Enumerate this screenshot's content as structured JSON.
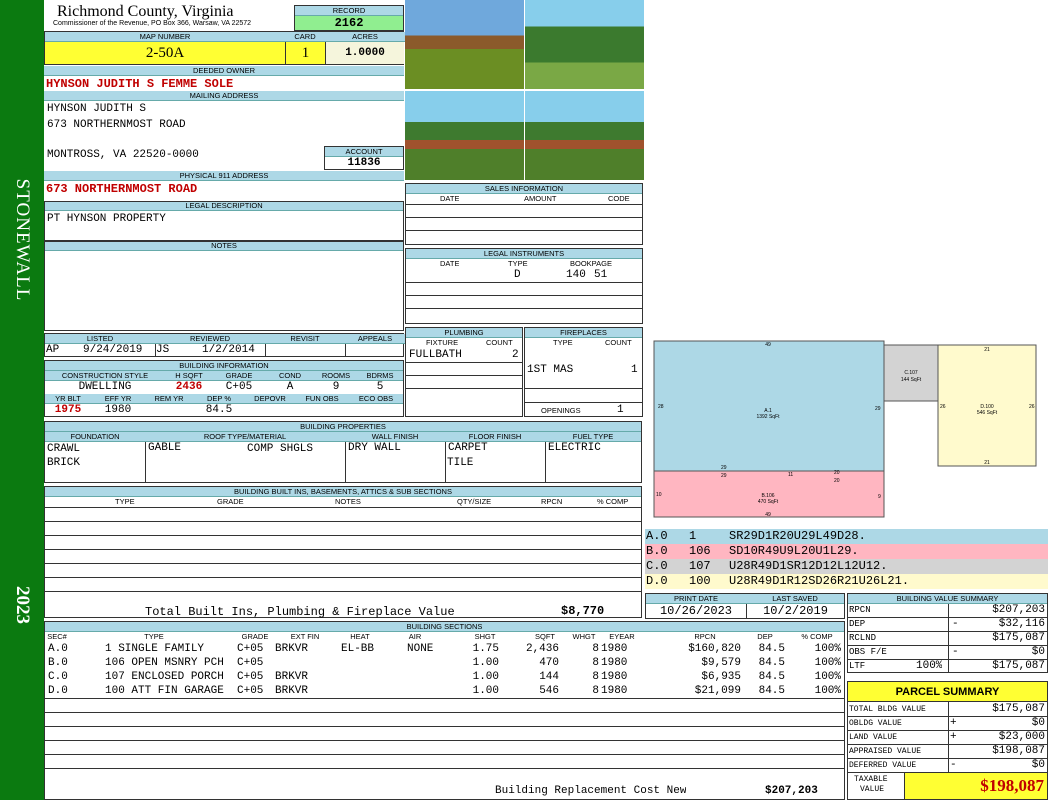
{
  "sidebar": {
    "district": "STONEWALL",
    "year": "2023"
  },
  "header": {
    "county": "Richmond County, Virginia",
    "commissioner": "Commissioner of the Revenue, PO Box 366, Warsaw, VA 22572",
    "record_label": "RECORD",
    "record": "2162",
    "map_label": "MAP NUMBER",
    "map_number": "2-50A",
    "card_label": "CARD",
    "card": "1",
    "acres_label": "ACRES",
    "acres": "1.0000"
  },
  "owner": {
    "deeded_label": "DEEDED OWNER",
    "deeded": "HYNSON JUDITH S FEMME SOLE",
    "mailing_label": "MAILING ADDRESS",
    "mail1": "HYNSON JUDITH S",
    "mail2": "673 NORTHERNMOST ROAD",
    "mail3": "MONTROSS, VA 22520-0000",
    "account_label": "ACCOUNT",
    "account": "11836",
    "physical_label": "PHYSICAL 911 ADDRESS",
    "physical": "673 NORTHERNMOST ROAD",
    "legal_label": "LEGAL DESCRIPTION",
    "legal": "PT HYNSON PROPERTY",
    "notes_label": "NOTES"
  },
  "listing": {
    "listed_label": "LISTED",
    "reviewed_label": "REVIEWED",
    "revisit_label": "REVISIT",
    "appeals_label": "APPEALS",
    "listed_by": "AP",
    "listed_date": "9/24/2019",
    "reviewed_by": "JS",
    "reviewed_date": "1/2/2014"
  },
  "building_info": {
    "label": "BUILDING INFORMATION",
    "h_style": "CONSTRUCTION STYLE",
    "h_sqft": "H SQFT",
    "h_grade": "GRADE",
    "h_cond": "COND",
    "h_rooms": "ROOMS",
    "h_bdrms": "BDRMS",
    "style": "DWELLING",
    "sqft": "2436",
    "grade": "C+05",
    "cond": "A",
    "rooms": "9",
    "bdrms": "5",
    "h_yrblt": "YR BLT",
    "h_effyr": "EFF YR",
    "h_remyr": "REM YR",
    "h_dep": "DEP %",
    "h_depovr": "DEPOVR",
    "h_funobs": "FUN OBS",
    "h_ecoobs": "ECO OBS",
    "yrblt": "1975",
    "effyr": "1980",
    "dep": "84.5"
  },
  "sales": {
    "label": "SALES INFORMATION",
    "h_date": "DATE",
    "h_amount": "AMOUNT",
    "h_code": "CODE"
  },
  "legal_inst": {
    "label": "LEGAL INSTRUMENTS",
    "h_date": "DATE",
    "h_type": "TYPE",
    "h_book": "BOOKPAGE",
    "type": "D",
    "book": "140",
    "page": "51"
  },
  "plumbing": {
    "label": "PLUMBING",
    "h_fixture": "FIXTURE",
    "h_count": "COUNT",
    "fixture": "FULLBATH",
    "count": "2"
  },
  "fireplaces": {
    "label": "FIREPLACES",
    "h_type": "TYPE",
    "h_count": "COUNT",
    "type": "1ST MAS",
    "count": "1",
    "openings_label": "OPENINGS",
    "openings": "1"
  },
  "properties": {
    "label": "BUILDING PROPERTIES",
    "h_found": "FOUNDATION",
    "h_roof": "ROOF TYPE/MATERIAL",
    "h_wall": "WALL FINISH",
    "h_floor": "FLOOR FINISH",
    "h_fuel": "FUEL TYPE",
    "found1": "CRAWL",
    "found2": "BRICK",
    "roof1": "GABLE",
    "roof2": "COMP SHGLS",
    "wall": "DRY WALL",
    "floor1": "CARPET",
    "floor2": "TILE",
    "fuel": "ELECTRIC"
  },
  "builtins": {
    "label": "BUILDING BUILT INS, BASEMENTS, ATTICS & SUB SECTIONS",
    "h_type": "TYPE",
    "h_grade": "GRADE",
    "h_notes": "NOTES",
    "h_qty": "QTY/SIZE",
    "h_rpcn": "RPCN",
    "h_comp": "% COMP",
    "total_label": "Total Built Ins, Plumbing & Fireplace Value",
    "total": "$8,770"
  },
  "sections": {
    "label": "BUILDING SECTIONS",
    "headers": [
      "SEC#",
      "TYPE",
      "GRADE",
      "EXT FIN",
      "HEAT",
      "AIR",
      "SHGT",
      "SQFT",
      "WHGT",
      "EYEAR",
      "RPCN",
      "DEP",
      "% COMP"
    ],
    "rows": [
      [
        "A.0",
        "1 SINGLE FAMILY",
        "C+05",
        "BRKVR",
        "EL-BB",
        "NONE",
        "1.75",
        "2,436",
        "8",
        "1980",
        "$160,820",
        "84.5",
        "100%"
      ],
      [
        "B.0",
        "106 OPEN MSNRY PCH",
        "C+05",
        "",
        "",
        "",
        "1.00",
        "470",
        "8",
        "1980",
        "$9,579",
        "84.5",
        "100%"
      ],
      [
        "C.0",
        "107 ENCLOSED PORCH",
        "C+05",
        "BRKVR",
        "",
        "",
        "1.00",
        "144",
        "8",
        "1980",
        "$6,935",
        "84.5",
        "100%"
      ],
      [
        "D.0",
        "100 ATT FIN GARAGE",
        "C+05",
        "BRKVR",
        "",
        "",
        "1.00",
        "546",
        "8",
        "1980",
        "$21,099",
        "84.5",
        "100%"
      ]
    ],
    "brcn_label": "Building Replacement Cost New",
    "brcn": "$207,203"
  },
  "sketch": {
    "a_label": "A.1",
    "a_area": "1392 SqFt",
    "b_label": "B.106",
    "b_area": "470 SqFt",
    "c_label": "C.107",
    "c_area": "144 SqFt",
    "d_label": "D.100",
    "d_area": "546 SqFt",
    "d49": "49",
    "d28": "28",
    "d29": "29",
    "d10": "10",
    "d9": "9",
    "d20": "20",
    "d11": "11",
    "d21": "21",
    "d26": "26"
  },
  "codes": [
    {
      "sec": "A.0",
      "num": "1",
      "code": "SR29D1R20U29L49D28.",
      "color": "#add8e6"
    },
    {
      "sec": "B.0",
      "num": "106",
      "code": "SD10R49U9L20U1L29.",
      "color": "#ffb6c1"
    },
    {
      "sec": "C.0",
      "num": "107",
      "code": "U28R49D1SR12D12L12U12.",
      "color": "#d3d3d3"
    },
    {
      "sec": "D.0",
      "num": "100",
      "code": "U28R49D1R12SD26R21U26L21.",
      "color": "#fffacd"
    }
  ],
  "dates": {
    "print_label": "PRINT DATE",
    "print": "10/26/2023",
    "saved_label": "LAST SAVED",
    "saved": "10/2/2019"
  },
  "bvs": {
    "label": "BUILDING VALUE SUMMARY",
    "rpcn_l": "RPCN",
    "rpcn": "$207,203",
    "dep_l": "DEP",
    "dep_s": "-",
    "dep": "$32,116",
    "rclnd_l": "RCLND",
    "rclnd": "$175,087",
    "obs_l": "OBS F/E",
    "obs_s": "-",
    "obs": "$0",
    "ltr_l": "LTF",
    "ltr_p": "100%",
    "ltr": "$175,087"
  },
  "parcel": {
    "label": "PARCEL SUMMARY",
    "tbv_l": "TOTAL BLDG VALUE",
    "tbv": "$175,087",
    "obldg_l": "OBLDG VALUE",
    "obldg_s": "+",
    "obldg": "$0",
    "land_l": "LAND VALUE",
    "land_s": "+",
    "land": "$23,000",
    "appr_l": "APPRAISED VALUE",
    "appr": "$198,087",
    "def_l": "DEFERRED VALUE",
    "def_s": "-",
    "def": "$0",
    "tax_l1": "TAXABLE",
    "tax_l2": "VALUE",
    "tax": "$198,087"
  }
}
